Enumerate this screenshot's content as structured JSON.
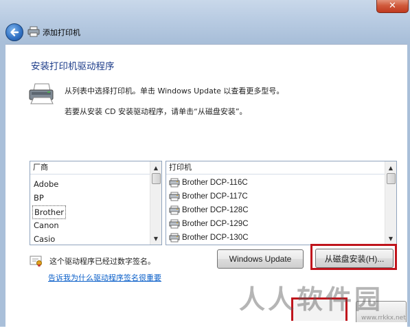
{
  "window": {
    "close_glyph": "✕"
  },
  "nav": {
    "title": "添加打印机"
  },
  "heading": "安装打印机驱动程序",
  "instructions": {
    "line1": "从列表中选择打印机。单击 Windows Update 以查看更多型号。",
    "line2": "若要从安装 CD 安装驱动程序，请单击“从磁盘安装”。"
  },
  "manufacturers": {
    "header": "厂商",
    "items": [
      "Adobe",
      "BP",
      "Brother",
      "Canon",
      "Casio"
    ],
    "selected": "Brother"
  },
  "printers": {
    "header": "打印机",
    "items": [
      "Brother DCP-116C",
      "Brother DCP-117C",
      "Brother DCP-128C",
      "Brother DCP-129C",
      "Brother DCP-130C"
    ]
  },
  "signed_text": "这个驱动程序已经过数字签名。",
  "signing_link": "告诉我为什么驱动程序签名很重要",
  "buttons": {
    "windows_update": "Windows Update",
    "have_disk": "从磁盘安装(H)..."
  },
  "watermark": {
    "text": "人人软件园",
    "url": "www.rrkkx.net"
  },
  "colors": {
    "accent_red": "#c0141c",
    "heading_blue": "#1e3d8a",
    "link_blue": "#0a5fc9"
  }
}
